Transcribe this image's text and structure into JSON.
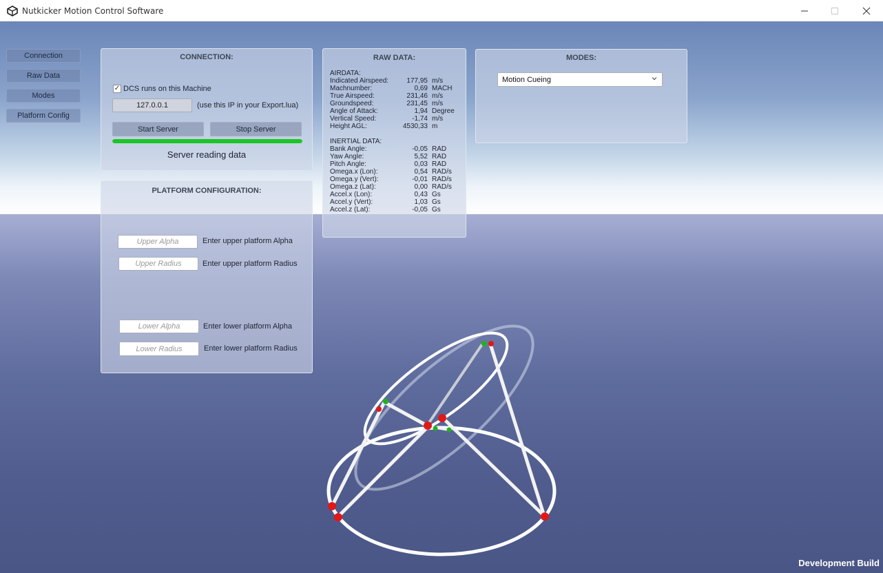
{
  "window": {
    "title": "Nutkicker Motion Control Software"
  },
  "nav": {
    "connection": "Connection",
    "raw_data": "Raw Data",
    "modes": "Modes",
    "platform_config": "Platform Config"
  },
  "connection": {
    "title": "CONNECTION:",
    "dcs_checkbox_label": "DCS runs on this Machine",
    "dcs_checked": true,
    "ip_value": "127.0.0.1",
    "ip_hint": "(use this IP in your Export.lua)",
    "start_button": "Start Server",
    "stop_button": "Stop Server",
    "progress_fraction": 1.0,
    "progress_color": "#18c624",
    "status": "Server reading data"
  },
  "platform": {
    "title": "PLATFORM CONFIGURATION:",
    "upper_alpha_placeholder": "Upper Alpha",
    "upper_alpha_label": "Enter upper platform Alpha",
    "upper_radius_placeholder": "Upper Radius",
    "upper_radius_label": "Enter upper platform Radius",
    "lower_alpha_placeholder": "Lower Alpha",
    "lower_alpha_label": "Enter lower platform Alpha",
    "lower_radius_placeholder": "Lower Radius",
    "lower_radius_label": "Enter lower platform Radius"
  },
  "raw": {
    "title": "RAW DATA:",
    "airdata_header": "AIRDATA:",
    "inertial_header": "INERTIAL DATA:",
    "airdata": [
      {
        "label": "Indicated Airspeed:",
        "value": "177,95",
        "unit": "m/s"
      },
      {
        "label": "Machnumber:",
        "value": "0,69",
        "unit": "MACH"
      },
      {
        "label": "True Airspeed:",
        "value": "231,46",
        "unit": "m/s"
      },
      {
        "label": "Groundspeed:",
        "value": "231,45",
        "unit": "m/s"
      },
      {
        "label": "Angle of Attack:",
        "value": "1,94",
        "unit": "Degree"
      },
      {
        "label": "Vertical Speed:",
        "value": "-1,74",
        "unit": "m/s"
      },
      {
        "label": "Height AGL:",
        "value": "4530,33",
        "unit": "m"
      }
    ],
    "inertial": [
      {
        "label": "Bank Angle:",
        "value": "-0,05",
        "unit": "RAD"
      },
      {
        "label": "Yaw Angle:",
        "value": "5,52",
        "unit": "RAD"
      },
      {
        "label": "Pitch Angle:",
        "value": "0,03",
        "unit": "RAD"
      },
      {
        "label": "Omega.x (Lon):",
        "value": "0,54",
        "unit": "RAD/s"
      },
      {
        "label": "Omega.y (Vert):",
        "value": "-0,01",
        "unit": "RAD/s"
      },
      {
        "label": "Omega.z (Lat):",
        "value": "0,00",
        "unit": "RAD/s"
      },
      {
        "label": "Accel.x (Lon):",
        "value": "0,43",
        "unit": "Gs"
      },
      {
        "label": "Accel.y (Vert):",
        "value": "1,03",
        "unit": "Gs"
      },
      {
        "label": "Accel.z (Lat):",
        "value": "-0,05",
        "unit": "Gs"
      }
    ]
  },
  "modes": {
    "title": "MODES:",
    "selected": "Motion Cueing"
  },
  "footer": {
    "dev_build": "Development Build"
  }
}
